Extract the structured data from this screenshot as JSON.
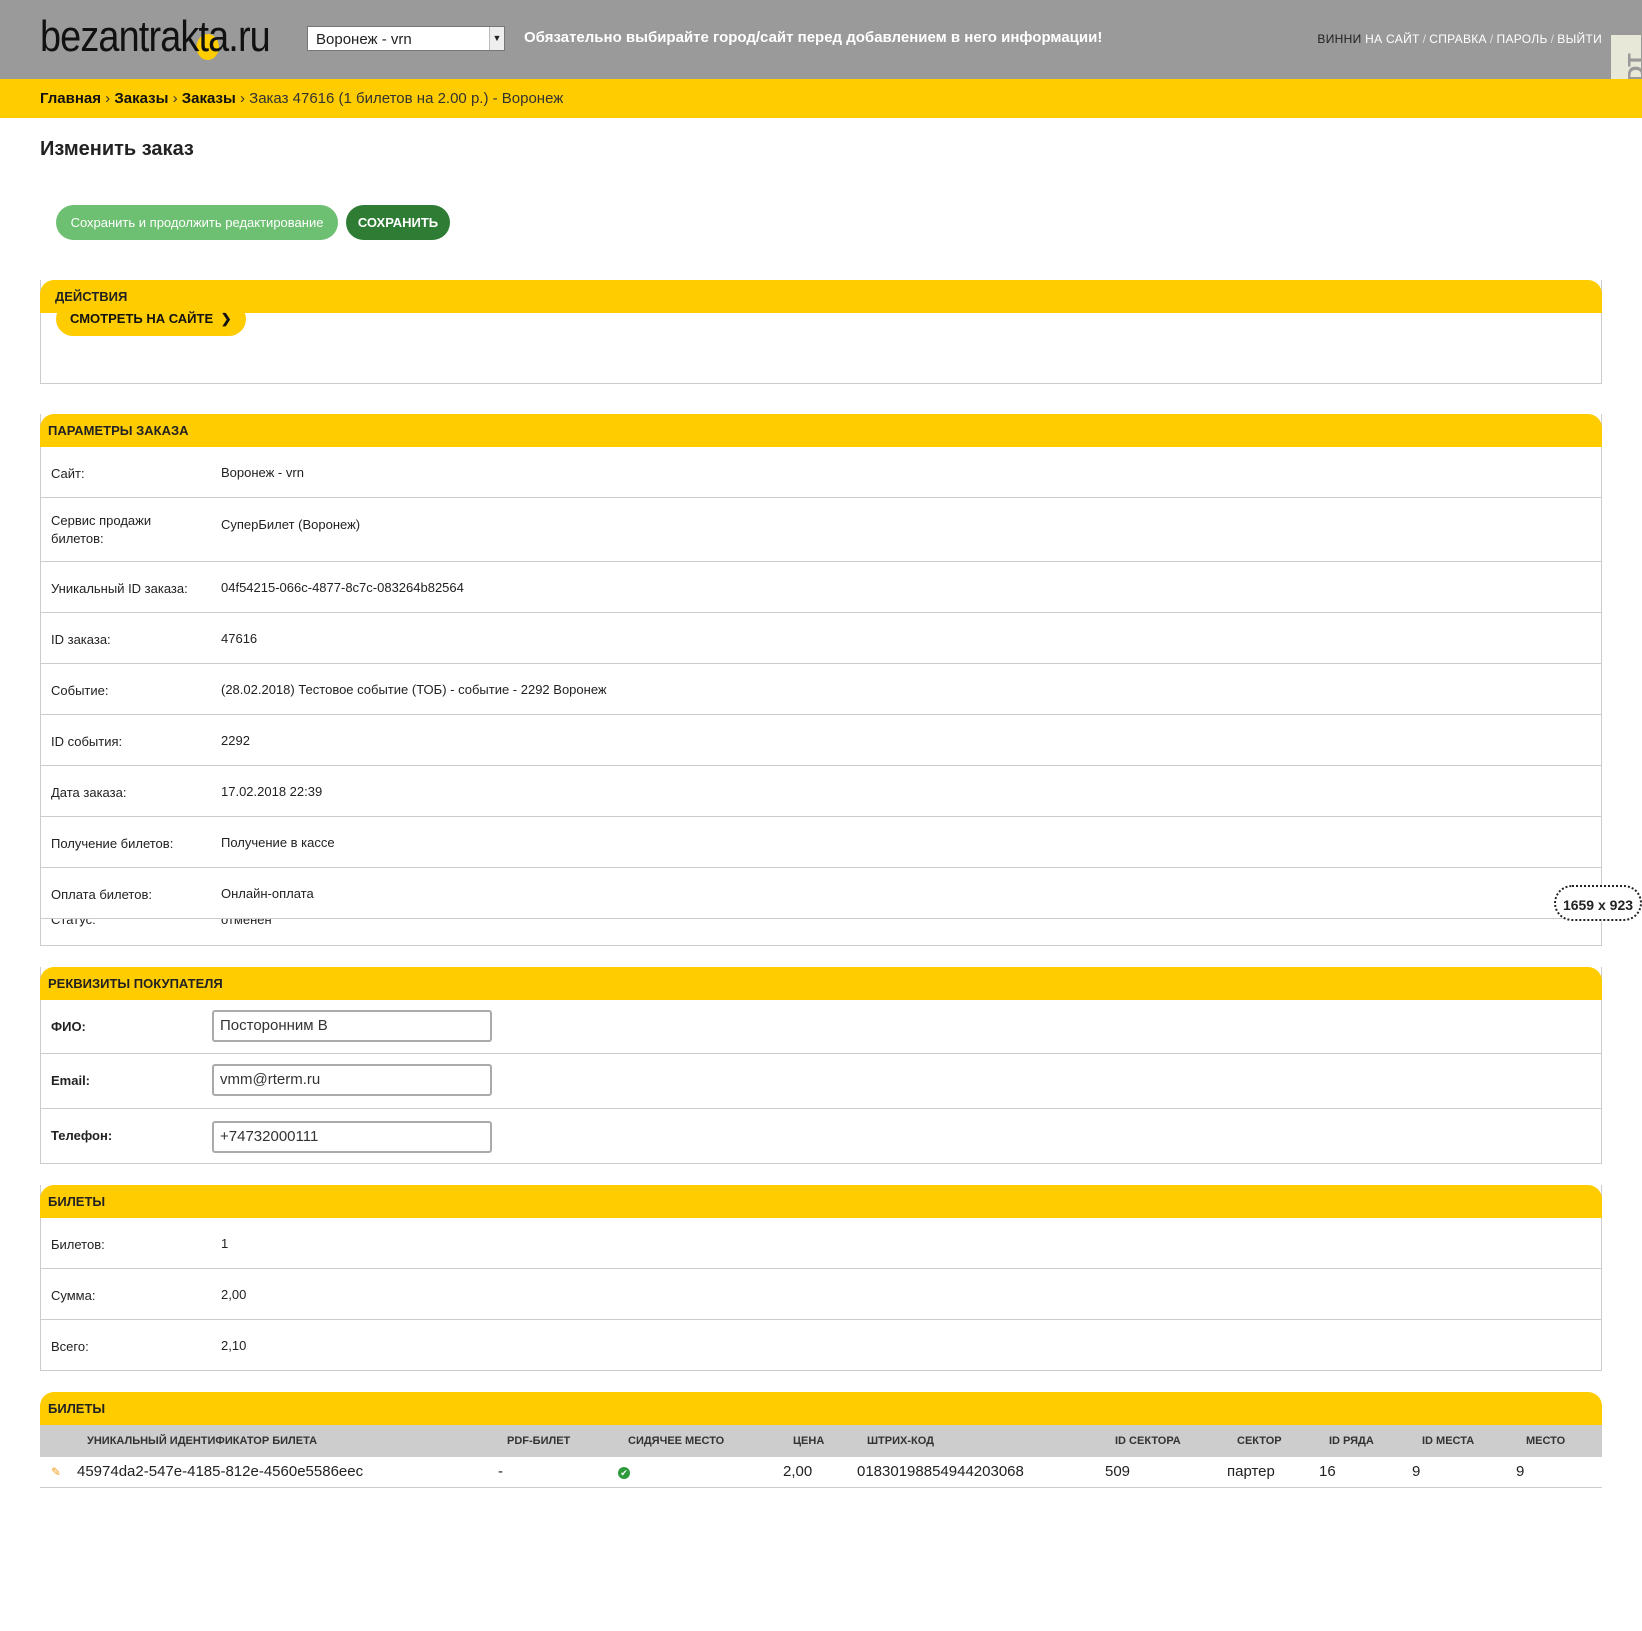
{
  "header": {
    "logo_text_a": "bezantrak",
    "logo_text_b": "t",
    "logo_text_c": "a.ru",
    "site_select": "Воронеж - vrn",
    "warning": "Обязательно выбирайте город/сайт перед добавлением в него информации!",
    "user": "ВИННИ",
    "links": [
      "НА САЙТ",
      "СПРАВКА",
      "ПАРОЛЬ",
      "ВЫЙТИ"
    ],
    "debug_toolbar": "DjDT"
  },
  "breadcrumbs": {
    "home": "Главная",
    "app": "Заказы",
    "model": "Заказы",
    "current": "Заказ 47616 (1 билетов на 2.00 р.) - Воронеж"
  },
  "page": {
    "title": "Изменить заказ",
    "save_continue": "Сохранить и продолжить редактирование",
    "save": "СОХРАНИТЬ"
  },
  "actions": {
    "title": "ДЕЙСТВИЯ",
    "view_on_site": "СМОТРЕТЬ НА САЙТЕ"
  },
  "params": {
    "title": "ПАРАМЕТРЫ ЗАКАЗА",
    "rows": [
      {
        "label": "Сайт:",
        "value": "Воронеж - vrn"
      },
      {
        "label": "Сервис продажи билетов:",
        "value": "СуперБилет (Воронеж)"
      },
      {
        "label": "Уникальный ID заказа:",
        "value": "04f54215-066c-4877-8c7c-083264b82564"
      },
      {
        "label": "ID заказа:",
        "value": "47616"
      },
      {
        "label": "Событие:",
        "value": "(28.02.2018) Тестовое событие (ТОБ) - событие - 2292 Воронеж"
      },
      {
        "label": "ID события:",
        "value": "2292"
      },
      {
        "label": "Дата заказа:",
        "value": "17.02.2018 22:39"
      },
      {
        "label": "Получение билетов:",
        "value": "Получение в кассе"
      },
      {
        "label": "Оплата билетов:",
        "value": "Онлайн-оплата"
      }
    ],
    "partial_label": "Статус:",
    "partial_value": "отменен"
  },
  "customer": {
    "title": "РЕКВИЗИТЫ ПОКУПАТЕЛЯ",
    "fio_label": "ФИО:",
    "fio_value": "Посторонним В",
    "email_label": "Email:",
    "email_value": "vmm@rterm.ru",
    "phone_label": "Телефон:",
    "phone_value": "+74732000111"
  },
  "tickets_summary": {
    "title": "БИЛЕТЫ",
    "rows": [
      {
        "label": "Билетов:",
        "value": "1"
      },
      {
        "label": "Сумма:",
        "value": "2,00"
      },
      {
        "label": "Всего:",
        "value": "2,10"
      }
    ]
  },
  "tickets_table": {
    "title": "БИЛЕТЫ",
    "columns": [
      "УНИКАЛЬНЫЙ ИДЕНТИФИКАТОР БИЛЕТА",
      "PDF-БИЛЕТ",
      "СИДЯЧЕЕ МЕСТО",
      "ЦЕНА",
      "ШТРИХ-КОД",
      "ID СЕКТОРА",
      "СЕКТОР",
      "ID РЯДА",
      "ID МЕСТА",
      "МЕСТО"
    ],
    "rows": [
      {
        "uid": "45974da2-547e-4185-812e-4560e5586eec",
        "pdf": "-",
        "seated": true,
        "price": "2,00",
        "barcode": "01830198854944203068",
        "sector_id": "509",
        "sector": "партер",
        "row_id": "16",
        "seat_id": "9",
        "seat": "9"
      }
    ]
  },
  "overlay": {
    "size_tag": "1659 x 923"
  },
  "colors": {
    "accent": "#ffcc00",
    "header_bg": "#9a9a9a",
    "save_green": "#2f7d35",
    "continue_green": "#6dbf72"
  }
}
